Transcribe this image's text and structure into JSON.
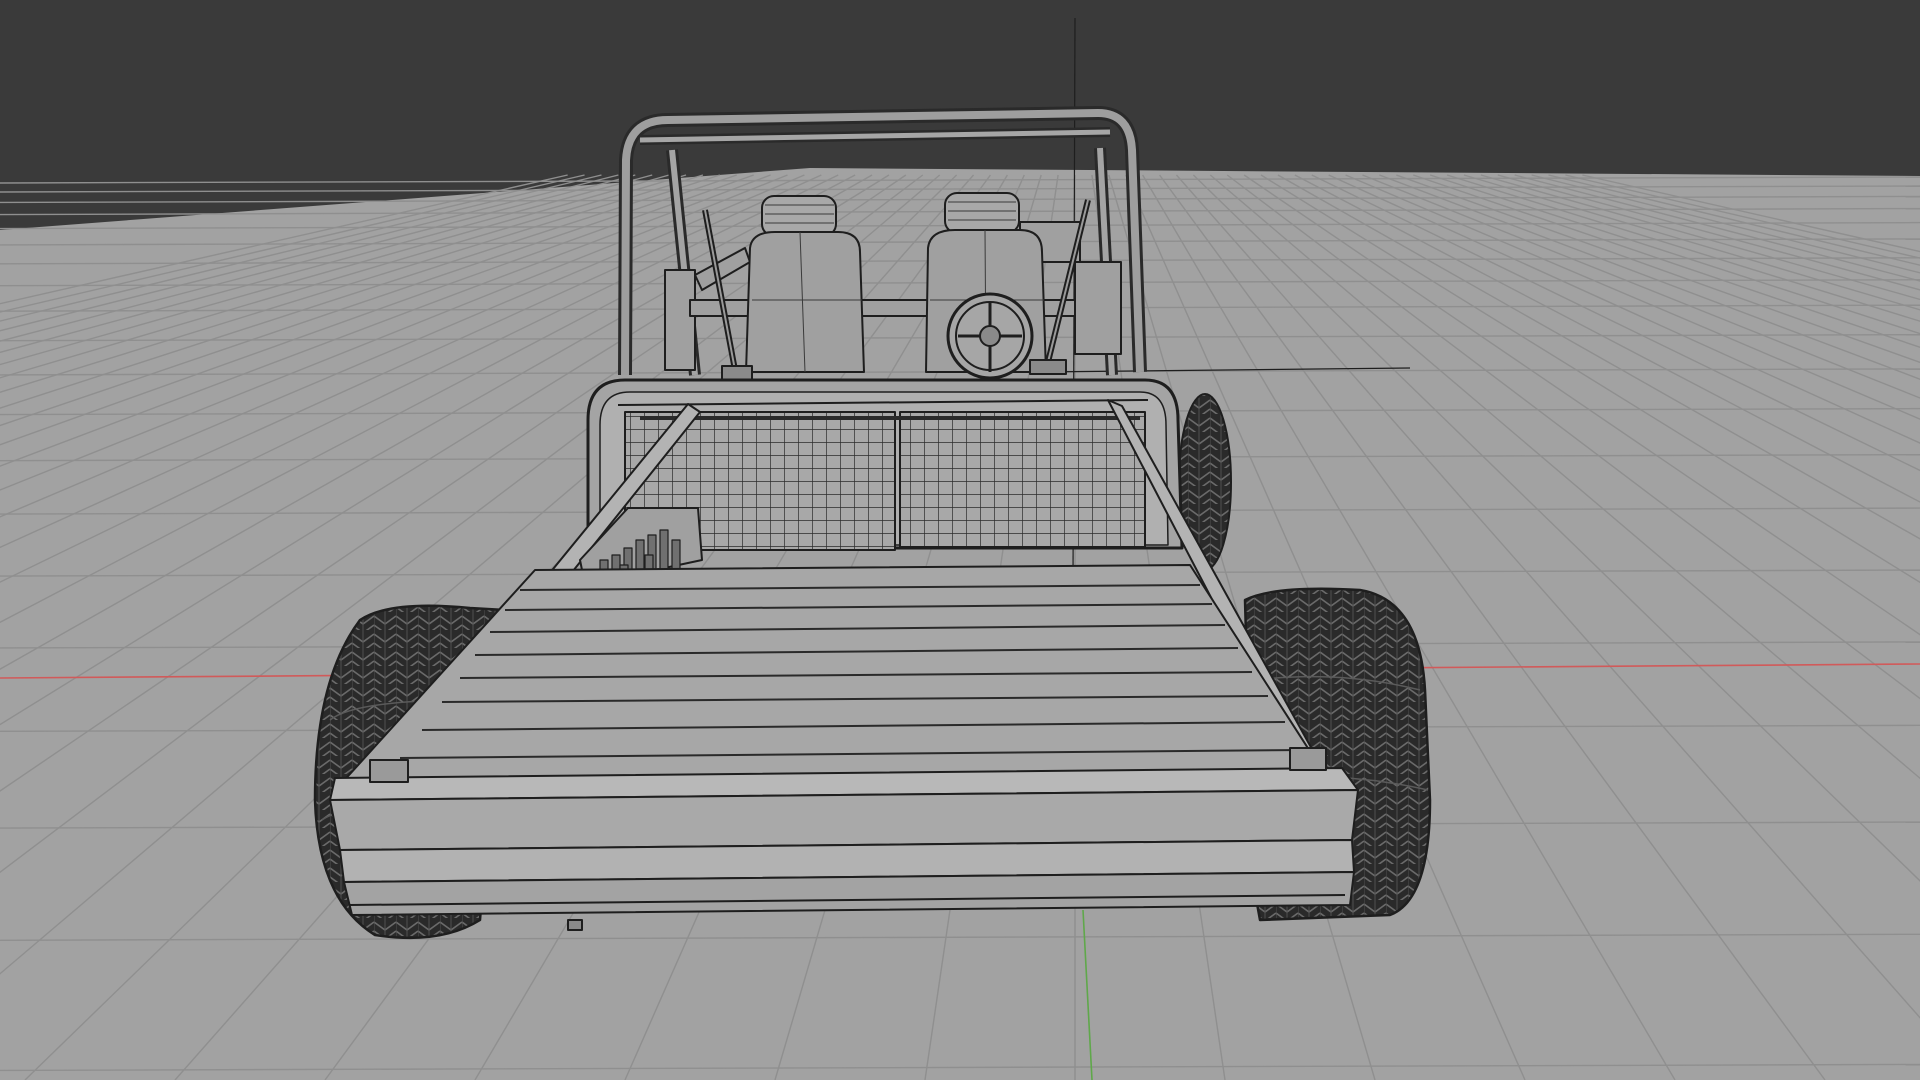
{
  "viewport": {
    "view": "3d-wireframe-viewport",
    "subject": "buggy-wireframe-model",
    "colors": {
      "sky": "#3a3a3a",
      "floor": "#a2a2a2",
      "grid": "#8f8f8f",
      "axis_x": "#d15a5a",
      "axis_y": "#5fa84a",
      "mesh_fill": "#9d9d9d",
      "mesh_light": "#b4b4b4",
      "wire": "#1e1e1e",
      "tire": "#2a2a2a"
    }
  }
}
